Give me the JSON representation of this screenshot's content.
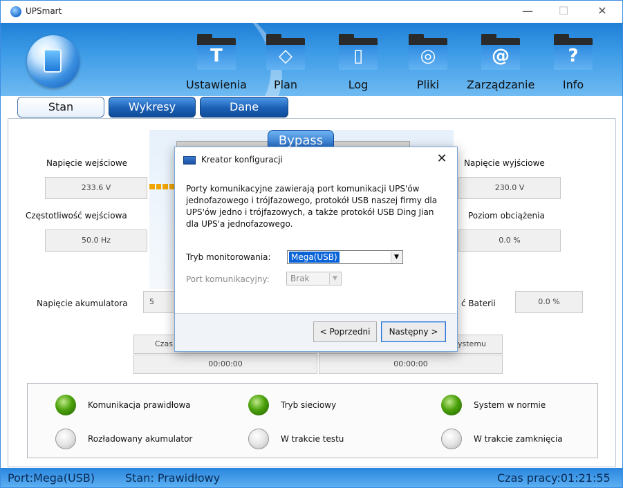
{
  "window": {
    "title": "UPSmart",
    "minimize_glyph": "—",
    "maximize_glyph": "☐",
    "close_glyph": "✕"
  },
  "toolbar": {
    "items": [
      {
        "label": "Ustawienia",
        "icon": "hammer-icon",
        "glyph": "T"
      },
      {
        "label": "Plan",
        "icon": "eraser-icon",
        "glyph": "◇"
      },
      {
        "label": "Log",
        "icon": "document-icon",
        "glyph": "▯"
      },
      {
        "label": "Pliki",
        "icon": "disc-icon",
        "glyph": "◎"
      },
      {
        "label": "Zarządzanie",
        "icon": "at-icon",
        "glyph": "@"
      },
      {
        "label": "Info",
        "icon": "question-icon",
        "glyph": "?"
      }
    ]
  },
  "tabs": [
    {
      "label": "Stan",
      "active": true
    },
    {
      "label": "Wykresy",
      "active": false
    },
    {
      "label": "Dane",
      "active": false
    }
  ],
  "main": {
    "bypass_label": "Bypass",
    "input_voltage": {
      "label": "Napięcie wejściowe",
      "value": "233.6 V"
    },
    "input_frequency": {
      "label": "Częstotliwość wejściowa",
      "value": "50.0 Hz"
    },
    "output_voltage": {
      "label": "Napięcie wyjściowe",
      "value": "230.0 V"
    },
    "load_level": {
      "label": "Poziom obciążenia",
      "value": "0.0 %"
    },
    "battery_voltage": {
      "label": "Napięcie akumulatora",
      "value": "5"
    },
    "battery_capacity": {
      "label": "ć Baterii",
      "value": "0.0 %"
    },
    "time_left": {
      "label": "Czas",
      "value": "00:00:00"
    },
    "system_time": {
      "label": "ystemu",
      "value": "00:00:00"
    }
  },
  "status": {
    "items": [
      {
        "label": "Komunikacja prawidłowa",
        "on": true
      },
      {
        "label": "Tryb sieciowy",
        "on": true
      },
      {
        "label": "System w normie",
        "on": true
      },
      {
        "label": "Rozładowany akumulator",
        "on": false
      },
      {
        "label": "W trakcie testu",
        "on": false
      },
      {
        "label": "W trakcie zamknięcia",
        "on": false
      }
    ],
    "colors": {
      "led_on": "#4ca20b",
      "led_off": "#e5e5e5"
    }
  },
  "statusbar": {
    "port": "Port:Mega(USB)",
    "state": "Stan: Prawidłowy",
    "uptime": "Czas pracy:01:21:55"
  },
  "dialog": {
    "title": "Kreator konfiguracji",
    "close_glyph": "✕",
    "description": "Porty komunikacyjne zawierają port komunikacji UPS'ów jednofazowego i trójfazowego, protokół USB naszej firmy dla UPS'ów jedno i trójfazowych, a także protokół USB Ding Jian dla UPS'a jednofazowego.",
    "monitor_mode": {
      "label": "Tryb monitorowania:",
      "value": "Mega(USB)"
    },
    "comm_port": {
      "label": "Port komunikacyjny:",
      "value": "Brak"
    },
    "prev_button": "< Poprzedni",
    "next_button": "Następny >"
  }
}
